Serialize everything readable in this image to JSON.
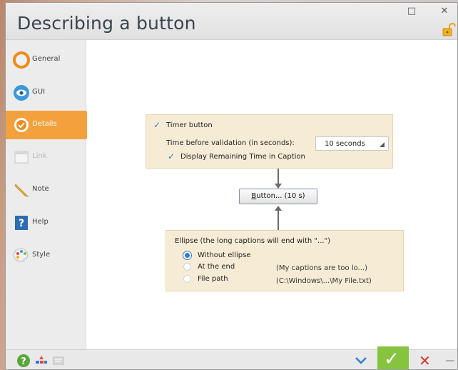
{
  "window": {
    "title": "Describing a button",
    "maximize_glyph": "□",
    "close_glyph": "✕"
  },
  "sidebar": {
    "items": [
      {
        "label": "General",
        "icon": "general-icon",
        "state": "normal"
      },
      {
        "label": "GUI",
        "icon": "eye-icon",
        "state": "normal"
      },
      {
        "label": "Details",
        "icon": "details-icon",
        "state": "active"
      },
      {
        "label": "Link",
        "icon": "link-icon",
        "state": "disabled"
      },
      {
        "label": "Note",
        "icon": "pencil-icon",
        "state": "normal"
      },
      {
        "label": "Help",
        "icon": "help-icon",
        "state": "normal"
      },
      {
        "label": "Style",
        "icon": "palette-icon",
        "state": "normal"
      }
    ]
  },
  "timer_panel": {
    "timer_checkbox_label": "Timer button",
    "timer_checked": true,
    "time_label": "Time before validation (in seconds):",
    "time_value": "10 seconds",
    "display_checkbox_label": "Display Remaining Time in Caption",
    "display_checked": true
  },
  "preview": {
    "button_label_underlined": "B",
    "button_label_rest": "utton... (10 s)"
  },
  "ellipse_panel": {
    "heading": "Ellipse (the long captions will end with \"...\")",
    "options": [
      {
        "label": "Without ellipse",
        "example": "",
        "selected": true
      },
      {
        "label": "At the end",
        "example": "(My captions are too lo...)",
        "selected": false
      },
      {
        "label": "File path",
        "example": "(C:\\Windows\\...\\My File.txt)",
        "selected": false
      }
    ]
  },
  "footer": {
    "check_glyph": "✓",
    "cancel_glyph": "✕"
  },
  "colors": {
    "accent_active": "#f3a13c",
    "panel_bg": "#f6ecd6",
    "ok_green": "#86c440",
    "cancel_red": "#d9342b",
    "check_blue": "#2f7bd6"
  }
}
